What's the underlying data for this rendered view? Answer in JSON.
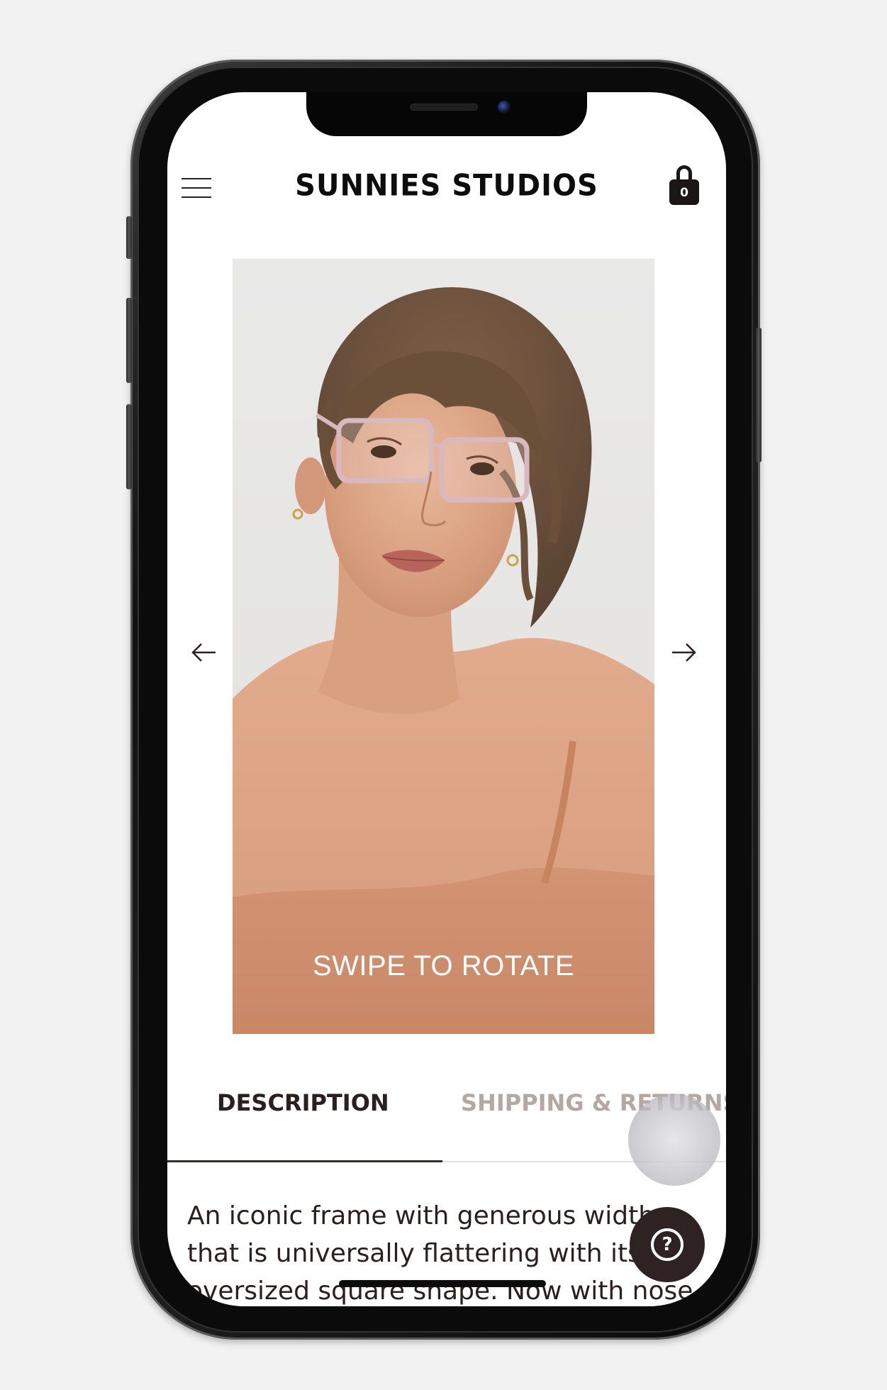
{
  "header": {
    "brand": "SUNNIES STUDIOS",
    "cart_count": "0"
  },
  "gallery": {
    "overlay_text": "SWIPE TO ROTATE"
  },
  "tabs": [
    {
      "label": "DESCRIPTION",
      "active": true
    },
    {
      "label": "SHIPPING & RETURNS",
      "active": false
    }
  ],
  "description": {
    "text": "An iconic frame with generous width that is universally flattering with its oversized square shape. Now with nose pads for a"
  },
  "help": {
    "icon_glyph": "?"
  },
  "colors": {
    "brand_text": "#0d0d0d",
    "accent_dark": "#2e2222",
    "tab_inactive": "#b5a8a4"
  }
}
